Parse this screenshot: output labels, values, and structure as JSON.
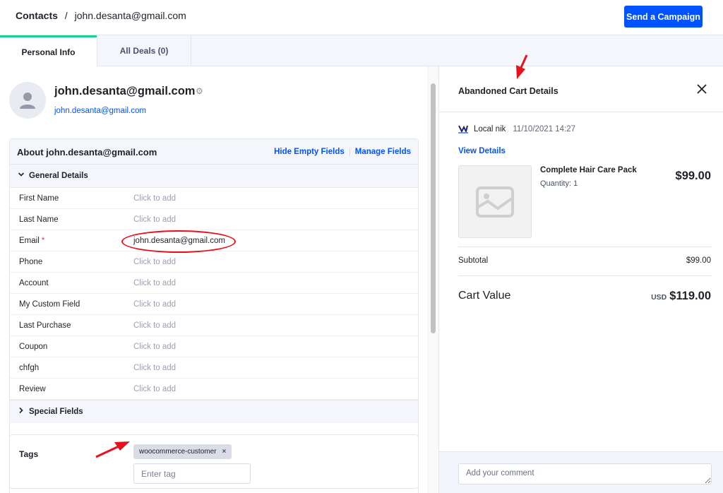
{
  "header": {
    "breadcrumb_root": "Contacts",
    "breadcrumb_sep": "/",
    "breadcrumb_current": "john.desanta@gmail.com",
    "send_campaign_label": "Send a Campaign"
  },
  "tabs": [
    {
      "label": "Personal Info",
      "active": true
    },
    {
      "label": "All Deals (0)",
      "active": false
    }
  ],
  "contact": {
    "name": "john.desanta@gmail.com",
    "email": "john.desanta@gmail.com",
    "settings_icon": "gear-icon"
  },
  "about": {
    "title": "About john.desanta@gmail.com",
    "hide_empty_label": "Hide Empty Fields",
    "manage_fields_label": "Manage Fields",
    "general_section": "General Details",
    "special_section": "Special Fields",
    "fields": [
      {
        "label": "First Name",
        "value": "Click to add",
        "required": false
      },
      {
        "label": "Last Name",
        "value": "Click to add",
        "required": false
      },
      {
        "label": "Email",
        "value": "john.desanta@gmail.com",
        "required": true
      },
      {
        "label": "Phone",
        "value": "Click to add",
        "required": false
      },
      {
        "label": "Account",
        "value": "Click to add",
        "required": false
      },
      {
        "label": "My Custom Field",
        "value": "Click to add",
        "required": false
      },
      {
        "label": "Last Purchase",
        "value": "Click to add",
        "required": false
      },
      {
        "label": "Coupon",
        "value": "Click to add",
        "required": false
      },
      {
        "label": "chfgh",
        "value": "Click to add",
        "required": false
      },
      {
        "label": "Review",
        "value": "Click to add",
        "required": false
      }
    ],
    "required_marker": "*"
  },
  "tags": {
    "label": "Tags",
    "items": [
      "woocommerce-customer"
    ],
    "remove_glyph": "×",
    "input_placeholder": "Enter tag"
  },
  "cart_panel": {
    "title": "Abandoned Cart Details",
    "close_glyph": "✕",
    "store_name": "Local nik",
    "date": "11/10/2021 14:27",
    "view_details_label": "View Details",
    "product": {
      "name": "Complete Hair Care Pack",
      "quantity": "Quantity: 1",
      "price": "$99.00"
    },
    "subtotal_label": "Subtotal",
    "subtotal_value": "$99.00",
    "cart_value_label": "Cart Value",
    "cart_value_currency": "USD",
    "cart_value": "$119.00",
    "comment_placeholder": "Add your comment"
  },
  "colors": {
    "primary": "#0052ff",
    "tab_accent": "#1dcf95",
    "annotation_red": "#e5121b"
  }
}
